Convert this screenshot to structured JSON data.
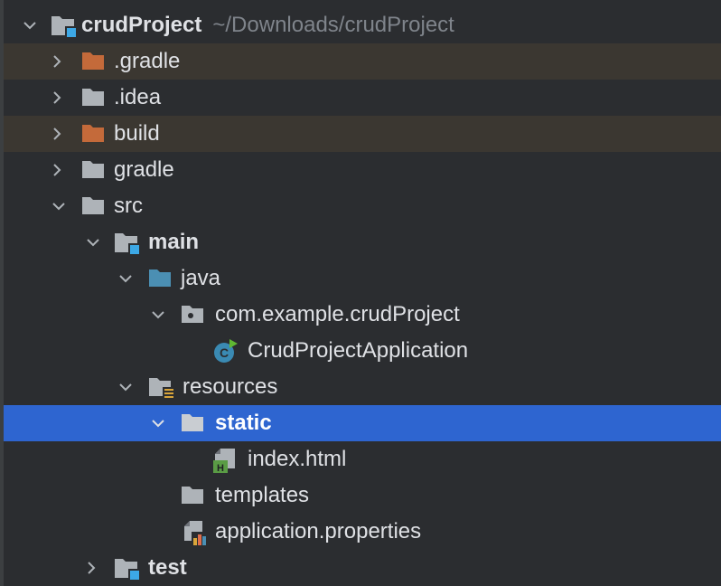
{
  "project": {
    "name": "crudProject",
    "path": "~/Downloads/crudProject"
  },
  "tree": {
    "gradle_dir": ".gradle",
    "idea_dir": ".idea",
    "build_dir": "build",
    "gradle_wrapper_dir": "gradle",
    "src_dir": "src",
    "main_dir": "main",
    "java_dir": "java",
    "package": "com.example.crudProject",
    "app_class": "CrudProjectApplication",
    "resources_dir": "resources",
    "static_dir": "static",
    "index_file": "index.html",
    "templates_dir": "templates",
    "properties_file": "application.properties",
    "test_dir": "test"
  },
  "icons": {
    "folder": "folder-icon",
    "excluded_folder": "excluded-folder-icon",
    "module_folder": "module-folder-icon",
    "source_root": "source-root-folder-icon",
    "resources_root": "resources-root-folder-icon",
    "package": "package-icon",
    "spring_class": "spring-boot-class-icon",
    "html_file": "html-file-icon",
    "properties_file": "properties-file-icon"
  },
  "colors": {
    "background": "#2b2d30",
    "selection": "#2e65d0",
    "excluded_row": "#3b3731",
    "excluded_folder": "#c46a3a",
    "folder": "#aeb3b8",
    "source_root": "#4b8fb3",
    "module_badge": "#3ca8e6"
  }
}
